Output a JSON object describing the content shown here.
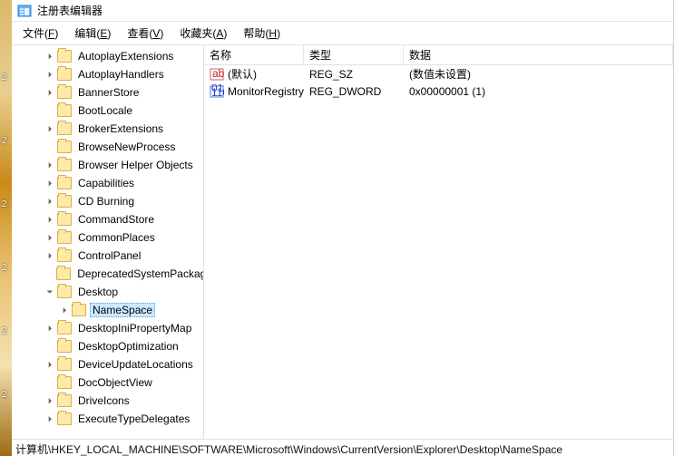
{
  "window": {
    "title": "注册表编辑器"
  },
  "menu": {
    "file_label": "文件(",
    "file_u": "F",
    "file_close": ")",
    "edit_label": "编辑(",
    "edit_u": "E",
    "edit_close": ")",
    "view_label": "查看(",
    "view_u": "V",
    "view_close": ")",
    "fav_label": "收藏夹(",
    "fav_u": "A",
    "fav_close": ")",
    "help_label": "帮助(",
    "help_u": "H",
    "help_close": ")"
  },
  "tree": {
    "items": [
      {
        "label": "AutoplayExtensions",
        "indent": 2,
        "chev": "right"
      },
      {
        "label": "AutoplayHandlers",
        "indent": 2,
        "chev": "right"
      },
      {
        "label": "BannerStore",
        "indent": 2,
        "chev": "right"
      },
      {
        "label": "BootLocale",
        "indent": 2,
        "chev": "none"
      },
      {
        "label": "BrokerExtensions",
        "indent": 2,
        "chev": "right"
      },
      {
        "label": "BrowseNewProcess",
        "indent": 2,
        "chev": "none"
      },
      {
        "label": "Browser Helper Objects",
        "indent": 2,
        "chev": "right"
      },
      {
        "label": "Capabilities",
        "indent": 2,
        "chev": "right"
      },
      {
        "label": "CD Burning",
        "indent": 2,
        "chev": "right"
      },
      {
        "label": "CommandStore",
        "indent": 2,
        "chev": "right"
      },
      {
        "label": "CommonPlaces",
        "indent": 2,
        "chev": "right"
      },
      {
        "label": "ControlPanel",
        "indent": 2,
        "chev": "right"
      },
      {
        "label": "DeprecatedSystemPackages",
        "indent": 2,
        "chev": "none"
      },
      {
        "label": "Desktop",
        "indent": 2,
        "chev": "down"
      },
      {
        "label": "NameSpace",
        "indent": 3,
        "chev": "right",
        "selected": true
      },
      {
        "label": "DesktopIniPropertyMap",
        "indent": 2,
        "chev": "right"
      },
      {
        "label": "DesktopOptimization",
        "indent": 2,
        "chev": "none"
      },
      {
        "label": "DeviceUpdateLocations",
        "indent": 2,
        "chev": "right"
      },
      {
        "label": "DocObjectView",
        "indent": 2,
        "chev": "none"
      },
      {
        "label": "DriveIcons",
        "indent": 2,
        "chev": "right"
      },
      {
        "label": "ExecuteTypeDelegates",
        "indent": 2,
        "chev": "right"
      }
    ]
  },
  "list": {
    "headers": {
      "name": "名称",
      "type": "类型",
      "data": "数据"
    },
    "rows": [
      {
        "icon": "string",
        "name": "(默认)",
        "type": "REG_SZ",
        "data": "(数值未设置)"
      },
      {
        "icon": "binary",
        "name": "MonitorRegistry",
        "type": "REG_DWORD",
        "data": "0x00000001 (1)"
      }
    ]
  },
  "status": {
    "path": "计算机\\HKEY_LOCAL_MACHINE\\SOFTWARE\\Microsoft\\Windows\\CurrentVersion\\Explorer\\Desktop\\NameSpace"
  },
  "strip_nums": [
    "2",
    "2",
    "2",
    "2",
    "2",
    "2"
  ]
}
